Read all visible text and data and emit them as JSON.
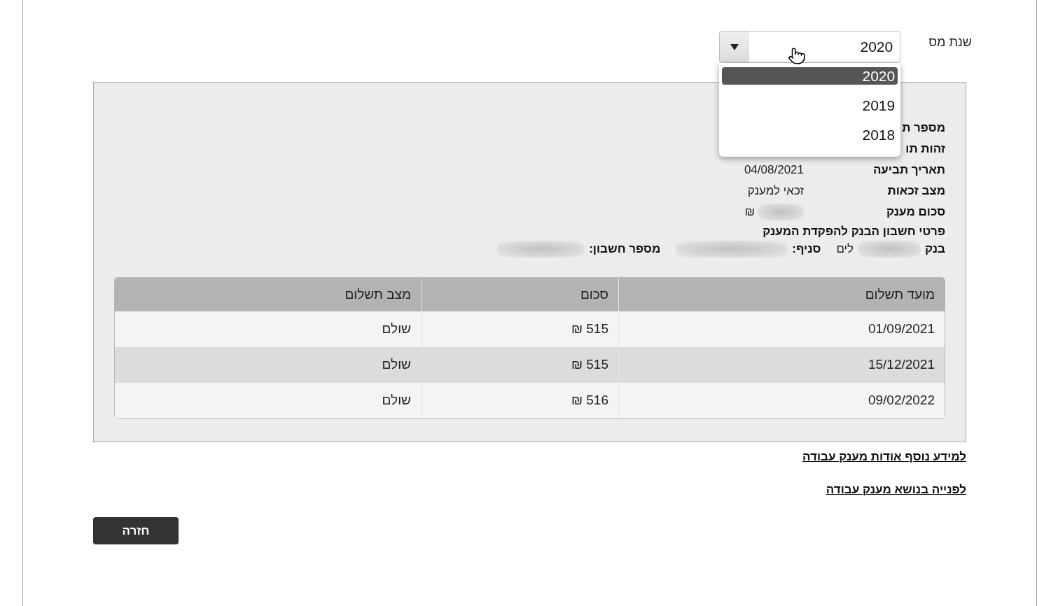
{
  "tax_year": {
    "label": "שנת מס",
    "value": "2020",
    "expanded": true,
    "options": [
      {
        "label": "2020",
        "selected": true
      },
      {
        "label": "2019",
        "selected": false
      },
      {
        "label": "2018",
        "selected": false
      }
    ]
  },
  "grant_details": {
    "rows": [
      {
        "kind": "field",
        "label": "מספר ת"
      },
      {
        "kind": "field",
        "label": "זהות תו"
      },
      {
        "kind": "field",
        "label": "תאריך תביעה",
        "value": "04/08/2021"
      },
      {
        "kind": "field",
        "label": "מצב זכאות",
        "value": "זכאי למענק"
      },
      {
        "kind": "field",
        "label": "סכום מענק",
        "value": "₪",
        "redacted": true
      },
      {
        "kind": "heading",
        "label": "פרטי חשבון הבנק להפקדת המענק"
      },
      {
        "kind": "inline",
        "parts": [
          {
            "label": "בנק",
            "value": "לים",
            "redacted": true
          },
          {
            "label": "סניף:",
            "redacted": true
          },
          {
            "label": "מספר חשבון:",
            "redacted": true
          }
        ]
      }
    ]
  },
  "payments_table": {
    "columns": [
      "מועד תשלום",
      "סכום",
      "מצב תשלום"
    ],
    "rows": [
      [
        "01/09/2021",
        "515 ₪",
        "שולם"
      ],
      [
        "15/12/2021",
        "515 ₪",
        "שולם"
      ],
      [
        "09/02/2022",
        "516 ₪",
        "שולם"
      ]
    ]
  },
  "links": [
    "למידע נוסף אודות מענק עבודה",
    "לפנייה בנושא מענק עבודה"
  ],
  "back_button": "חזרה"
}
